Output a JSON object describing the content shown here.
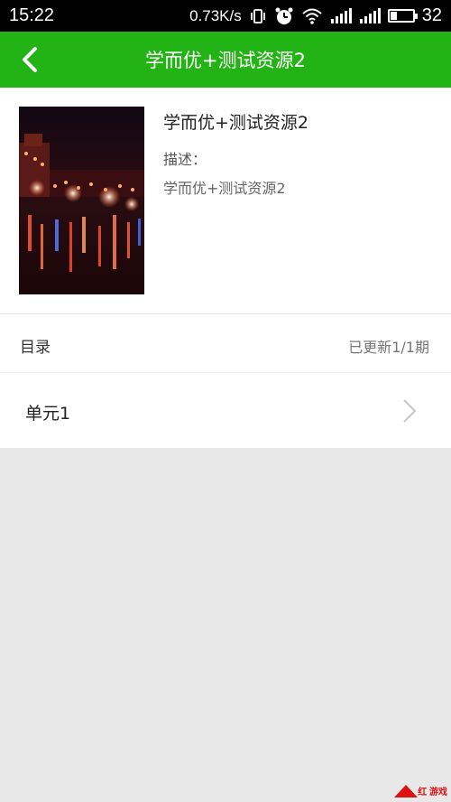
{
  "status_bar": {
    "time": "15:22",
    "net_speed": "0.73K/s",
    "battery": "32",
    "icons": [
      "vibrate-icon",
      "alarm-icon",
      "wifi-icon",
      "signal-icon",
      "signal-icon",
      "battery-icon"
    ],
    "battery_level": 0.32
  },
  "header": {
    "title": "学而优+测试资源2",
    "bg_color": "#22b314"
  },
  "resource": {
    "title": "学而优+测试资源2",
    "desc_label": "描述：",
    "desc_text": "学而优+测试资源2"
  },
  "catalog": {
    "label": "目录",
    "status": "已更新1/1期"
  },
  "units": [
    {
      "label": "单元1"
    }
  ],
  "watermark": {
    "text": "红 游戏",
    "url": "www.redshu.com"
  }
}
